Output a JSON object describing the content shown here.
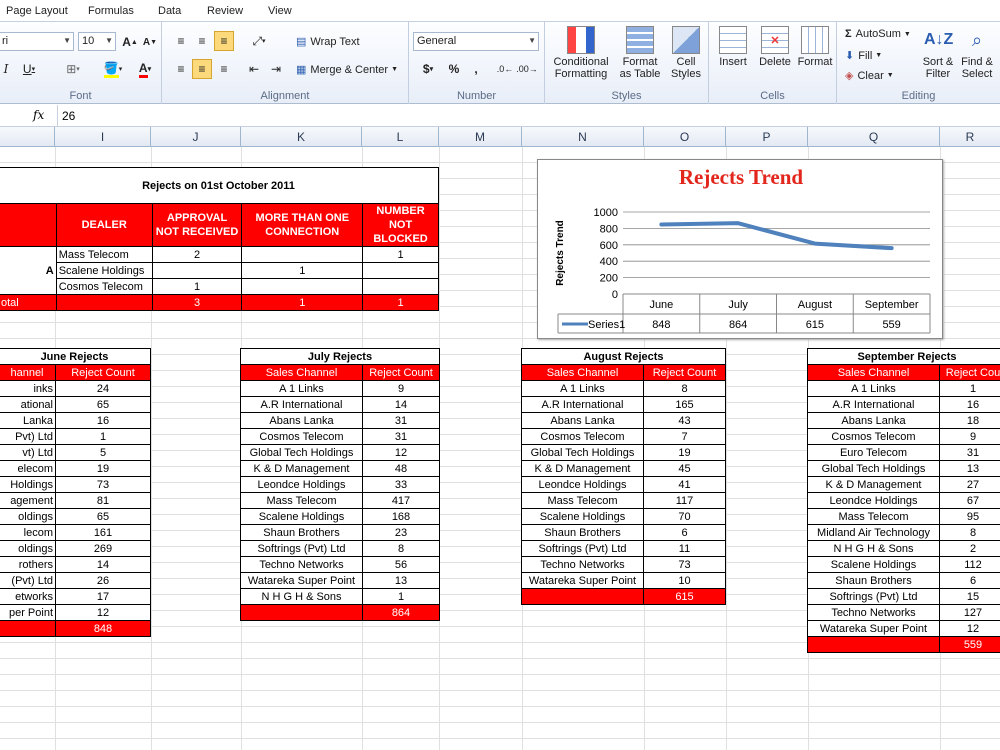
{
  "tabs": [
    "Page Layout",
    "Formulas",
    "Data",
    "Review",
    "View"
  ],
  "ribbon": {
    "font_name": "ri",
    "font_size": "10",
    "font_group": "Font",
    "alignment_group": "Alignment",
    "number_group": "Number",
    "styles_group": "Styles",
    "cells_group": "Cells",
    "editing_group": "Editing",
    "wrap_text": "Wrap Text",
    "merge_center": "Merge & Center",
    "number_format": "General",
    "currency": "$",
    "percent": "%",
    "comma": ",",
    "cond1": "Conditional",
    "cond2": "Formatting",
    "fmt1": "Format",
    "fmt2": "as Table",
    "cs1": "Cell",
    "cs2": "Styles",
    "insert": "Insert",
    "delete": "Delete",
    "format": "Format",
    "autosum": "AutoSum",
    "fill": "Fill",
    "clear": "Clear",
    "sort1": "Sort &",
    "sort2": "Filter",
    "find1": "Find &",
    "find2": "Select"
  },
  "formula": {
    "fx": "fx",
    "value": "26"
  },
  "columns": [
    "I",
    "J",
    "K",
    "L",
    "M",
    "N",
    "O",
    "P",
    "Q",
    "R"
  ],
  "rejects_oct": {
    "title": "Rejects on  01st October  2011",
    "h_dealer": "DEALER",
    "h_approval": "APPROVAL NOT RECEIVED",
    "h_more": "MORE THAN ONE CONNECTION",
    "h_number": "NUMBER NOT BLOCKED",
    "group_label": "A",
    "rows": [
      {
        "dealer": "Mass Telecom",
        "approval": "2",
        "more": "",
        "number": "1"
      },
      {
        "dealer": "Scalene Holdings",
        "approval": "",
        "more": "1",
        "number": ""
      },
      {
        "dealer": "Cosmos Telecom",
        "approval": "1",
        "more": "",
        "number": ""
      }
    ],
    "total_label": "otal",
    "total_approval": "3",
    "total_more": "1",
    "total_number": "1"
  },
  "chart_data": {
    "type": "line",
    "title": "Rejects Trend",
    "ylabel": "Rejects Trend",
    "categories": [
      "June",
      "July",
      "August",
      "September"
    ],
    "series": [
      {
        "name": "Series1",
        "values": [
          848,
          864,
          615,
          559
        ],
        "color": "#4f81bd"
      }
    ],
    "ylim": [
      0,
      1000
    ],
    "yticks": [
      "1000",
      "800",
      "600",
      "400",
      "200",
      "0"
    ],
    "grid": true,
    "legend": "data-table"
  },
  "june": {
    "title": "June Rejects",
    "h1": "hannel",
    "h2": "Reject Count",
    "total": "848",
    "rows": [
      [
        "inks",
        "24"
      ],
      [
        "ational",
        "65"
      ],
      [
        "Lanka",
        "16"
      ],
      [
        "Pvt) Ltd",
        "1"
      ],
      [
        "vt) Ltd",
        "5"
      ],
      [
        "elecom",
        "19"
      ],
      [
        "Holdings",
        "73"
      ],
      [
        "agement",
        "81"
      ],
      [
        "oldings",
        "65"
      ],
      [
        "lecom",
        "161"
      ],
      [
        "oldings",
        "269"
      ],
      [
        "rothers",
        "14"
      ],
      [
        "(Pvt) Ltd",
        "26"
      ],
      [
        "etworks",
        "17"
      ],
      [
        "per Point",
        "12"
      ]
    ]
  },
  "july": {
    "title": "July Rejects",
    "h1": "Sales Channel",
    "h2": "Reject Count",
    "total": "864",
    "rows": [
      [
        "A 1 Links",
        "9"
      ],
      [
        "A.R International",
        "14"
      ],
      [
        "Abans Lanka",
        "31"
      ],
      [
        "Cosmos Telecom",
        "31"
      ],
      [
        "Global Tech Holdings",
        "12"
      ],
      [
        "K & D Management",
        "48"
      ],
      [
        "Leondce Holdings",
        "33"
      ],
      [
        "Mass Telecom",
        "417"
      ],
      [
        "Scalene Holdings",
        "168"
      ],
      [
        "Shaun Brothers",
        "23"
      ],
      [
        "Softrings (Pvt) Ltd",
        "8"
      ],
      [
        "Techno Networks",
        "56"
      ],
      [
        "Watareka Super Point",
        "13"
      ],
      [
        "N H G H & Sons",
        "1"
      ]
    ]
  },
  "august": {
    "title": "August Rejects",
    "h1": "Sales Channel",
    "h2": "Reject Count",
    "total": "615",
    "rows": [
      [
        "A 1 Links",
        "8"
      ],
      [
        "A.R International",
        "165"
      ],
      [
        "Abans Lanka",
        "43"
      ],
      [
        "Cosmos Telecom",
        "7"
      ],
      [
        "Global Tech Holdings",
        "19"
      ],
      [
        "K & D Management",
        "45"
      ],
      [
        "Leondce Holdings",
        "41"
      ],
      [
        "Mass Telecom",
        "117"
      ],
      [
        "Scalene Holdings",
        "70"
      ],
      [
        "Shaun Brothers",
        "6"
      ],
      [
        "Softrings (Pvt) Ltd",
        "11"
      ],
      [
        "Techno Networks",
        "73"
      ],
      [
        "Watareka Super Point",
        "10"
      ]
    ]
  },
  "september": {
    "title": "September Rejects",
    "h1": "Sales Channel",
    "h2": "Reject Cou",
    "total": "559",
    "rows": [
      [
        "A 1 Links",
        "1"
      ],
      [
        "A.R International",
        "16"
      ],
      [
        "Abans Lanka",
        "18"
      ],
      [
        "Cosmos Telecom",
        "9"
      ],
      [
        "Euro Telecom",
        "31"
      ],
      [
        "Global Tech Holdings",
        "13"
      ],
      [
        "K & D Management",
        "27"
      ],
      [
        "Leondce Holdings",
        "67"
      ],
      [
        "Mass Telecom",
        "95"
      ],
      [
        "Midland Air Technology",
        "8"
      ],
      [
        "N H G H & Sons",
        "2"
      ],
      [
        "Scalene Holdings",
        "112"
      ],
      [
        "Shaun Brothers",
        "6"
      ],
      [
        "Softrings (Pvt) Ltd",
        "15"
      ],
      [
        "Techno Networks",
        "127"
      ],
      [
        "Watareka Super Point",
        "12"
      ]
    ]
  }
}
